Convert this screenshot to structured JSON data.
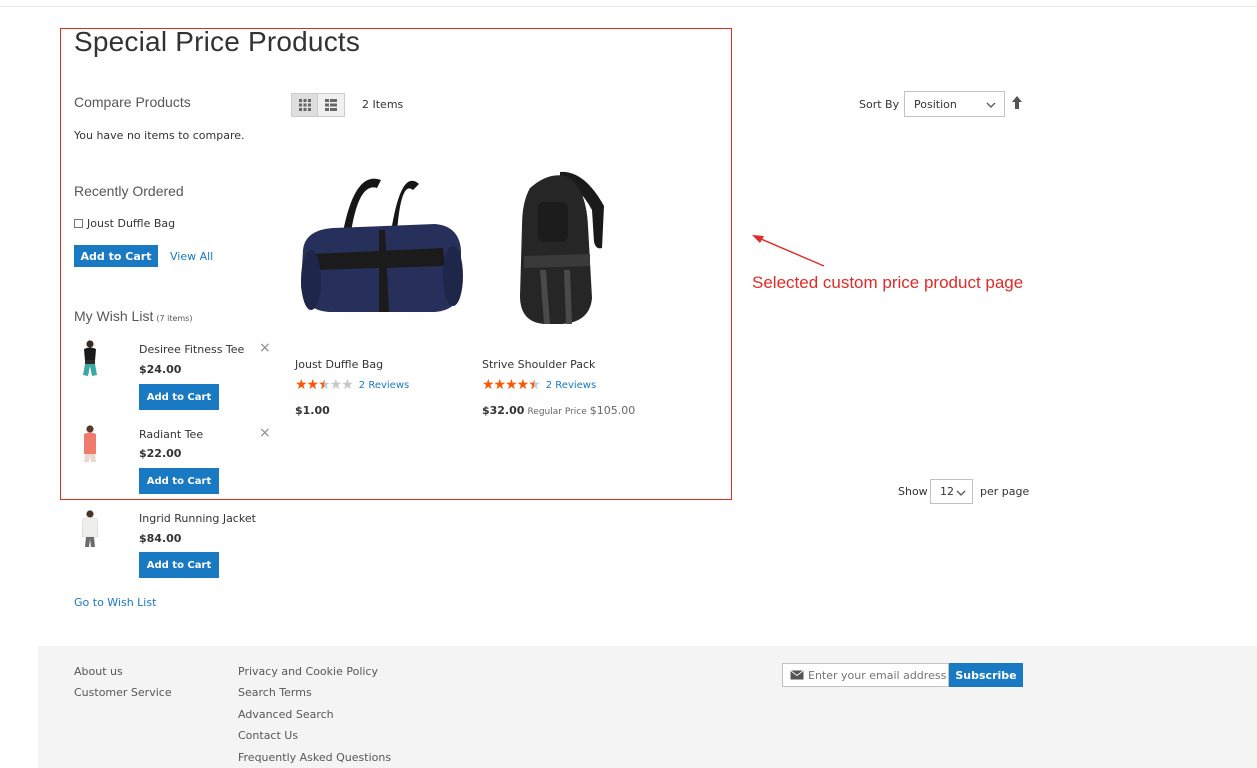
{
  "page": {
    "title": "Special Price Products"
  },
  "compare": {
    "title": "Compare Products",
    "empty_text": "You have no items to compare."
  },
  "recently_ordered": {
    "title": "Recently Ordered",
    "items": [
      {
        "label": "Joust Duffle Bag"
      }
    ],
    "add_to_cart": "Add to Cart",
    "view_all": "View All"
  },
  "wishlist": {
    "title": "My Wish List",
    "count": "(7 items)",
    "items": [
      {
        "name": "Desiree Fitness Tee",
        "price": "$24.00",
        "button": "Add to Cart",
        "remove": "×"
      },
      {
        "name": "Radiant Tee",
        "price": "$22.00",
        "button": "Add to Cart",
        "remove": "×"
      },
      {
        "name": "Ingrid Running Jacket",
        "price": "$84.00",
        "button": "Add to Cart"
      }
    ],
    "go_to": "Go to Wish List"
  },
  "toolbar": {
    "grid_icon": "grid-icon",
    "list_icon": "list-icon",
    "count": "2 Items",
    "sort_label": "Sort By",
    "sort_value": "Position",
    "show_label": "Show",
    "show_value": "12",
    "per_page": "per page"
  },
  "products": [
    {
      "name": "Joust Duffle Bag",
      "rating": 2.5,
      "reviews": "2 Reviews",
      "price": "$1.00",
      "regular_label": "",
      "regular_price": ""
    },
    {
      "name": "Strive Shoulder Pack",
      "rating": 4.5,
      "reviews": "2 Reviews",
      "price": "$32.00",
      "regular_label": "Regular Price",
      "regular_price": "$105.00"
    }
  ],
  "annotation": {
    "text": "Selected custom price product page",
    "color": "#e02b27"
  },
  "footer": {
    "col1": [
      "About us",
      "Customer Service"
    ],
    "col2": [
      "Privacy and Cookie Policy",
      "Search Terms",
      "Advanced Search",
      "Contact Us",
      "Frequently Asked Questions"
    ],
    "newsletter_placeholder": "Enter your email address",
    "subscribe": "Subscribe"
  },
  "colors": {
    "accent": "#1979c3",
    "star": "#ff5501",
    "annotation": "#e02b27"
  }
}
